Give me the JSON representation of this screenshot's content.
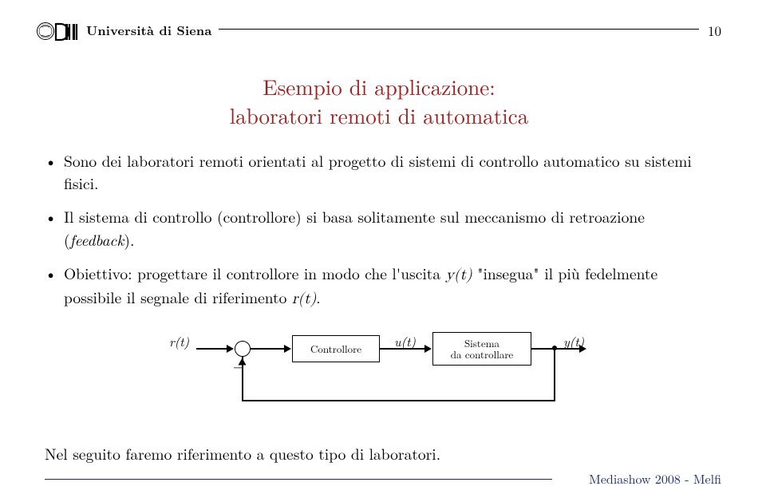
{
  "header": {
    "institution": "Università di Siena",
    "page_number": "10"
  },
  "title": {
    "line1": "Esempio di applicazione:",
    "line2": "laboratori remoti di automatica"
  },
  "bullets": {
    "b1": "Sono dei laboratori remoti orientati al progetto di sistemi di controllo automatico su sistemi fisici.",
    "b2_a": "Il sistema di controllo (controllore) si basa solitamente sul meccanismo di retroazione (",
    "b2_b": "feedback",
    "b2_c": ").",
    "b3_a": "Obiettivo: progettare il controllore in modo che l'uscita ",
    "b3_b": "y(t)",
    "b3_c": " \"insegua\" il più fedelmente possibile il segnale di riferimento ",
    "b3_d": "r(t)",
    "b3_e": "."
  },
  "diagram": {
    "r": "r(t)",
    "u": "u(t)",
    "y": "y(t)",
    "minus": "−",
    "controller": "Controllore",
    "plant_line1": "Sistema",
    "plant_line2": "da controllare"
  },
  "conclusion": "Nel seguito faremo riferimento a questo tipo di laboratori.",
  "footer": "Mediashow 2008 - Melfi"
}
